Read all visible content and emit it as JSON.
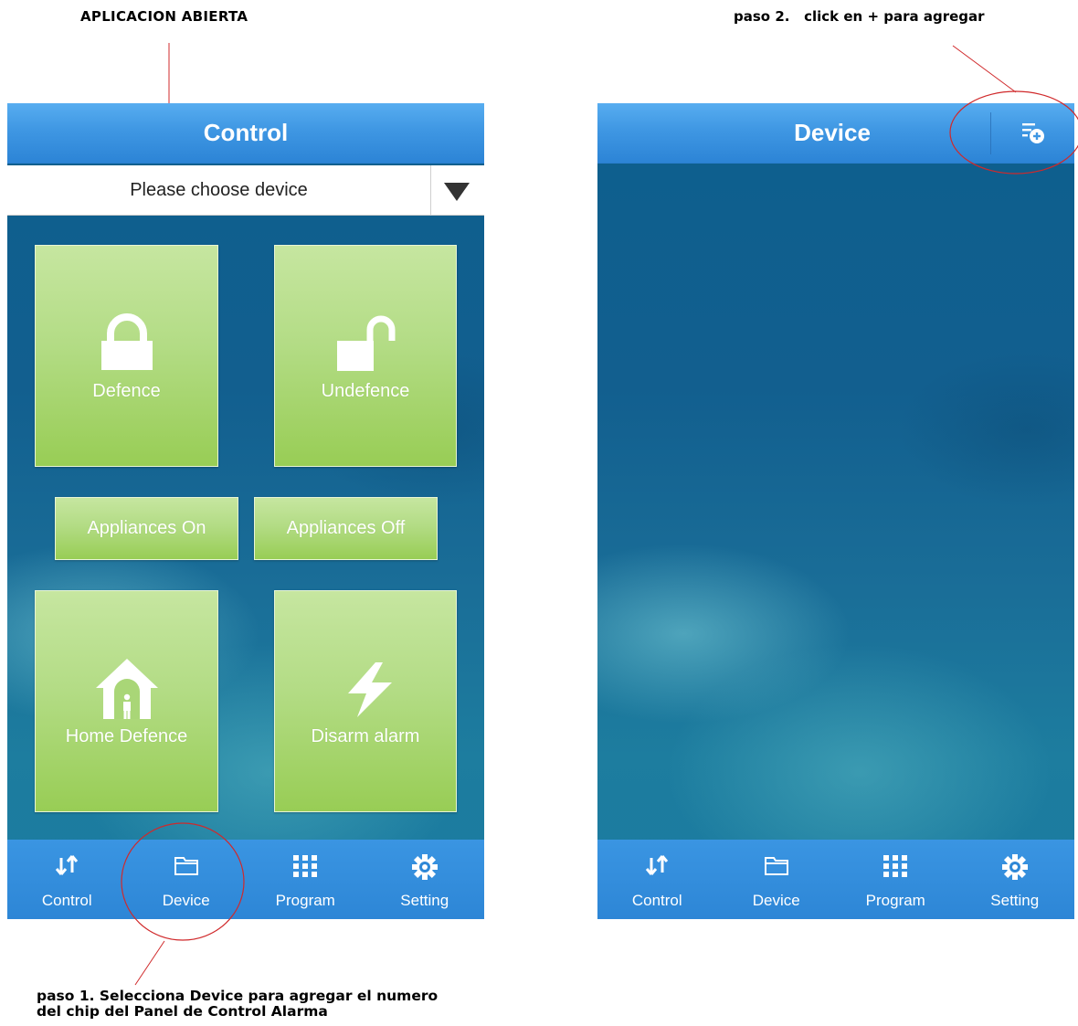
{
  "annotations": {
    "top_left": "APLICACION  ABIERTA",
    "top_right": "paso 2.   click en + para agregar",
    "bottom_line1": "paso 1. Selecciona  Device para agregar el numero",
    "bottom_line2": "del chip del Panel de Control Alarma"
  },
  "control_screen": {
    "title": "Control",
    "device_select": {
      "value": "Please choose device"
    },
    "tiles": {
      "defence": {
        "label": "Defence",
        "icon": "locked-padlock-icon"
      },
      "undefence": {
        "label": "Undefence",
        "icon": "unlocked-padlock-icon"
      },
      "appliances_on": {
        "label": "Appliances On"
      },
      "appliances_off": {
        "label": "Appliances Off"
      },
      "home_defence": {
        "label": "Home Defence",
        "icon": "house-person-icon"
      },
      "disarm_alarm": {
        "label": "Disarm alarm",
        "icon": "lightning-icon"
      }
    }
  },
  "device_screen": {
    "title": "Device",
    "add_button_icon": "list-add-icon"
  },
  "tabbar": {
    "items": [
      {
        "label": "Control",
        "icon": "up-down-arrows-icon"
      },
      {
        "label": "Device",
        "icon": "folder-icon"
      },
      {
        "label": "Program",
        "icon": "grid-icon"
      },
      {
        "label": "Setting",
        "icon": "gear-icon"
      }
    ]
  },
  "colors": {
    "title_bar": "#3f97e3",
    "tab_bar": "#2d86d6",
    "tile_green": "#b3dc85",
    "annotation_circle": "#d0292b"
  }
}
